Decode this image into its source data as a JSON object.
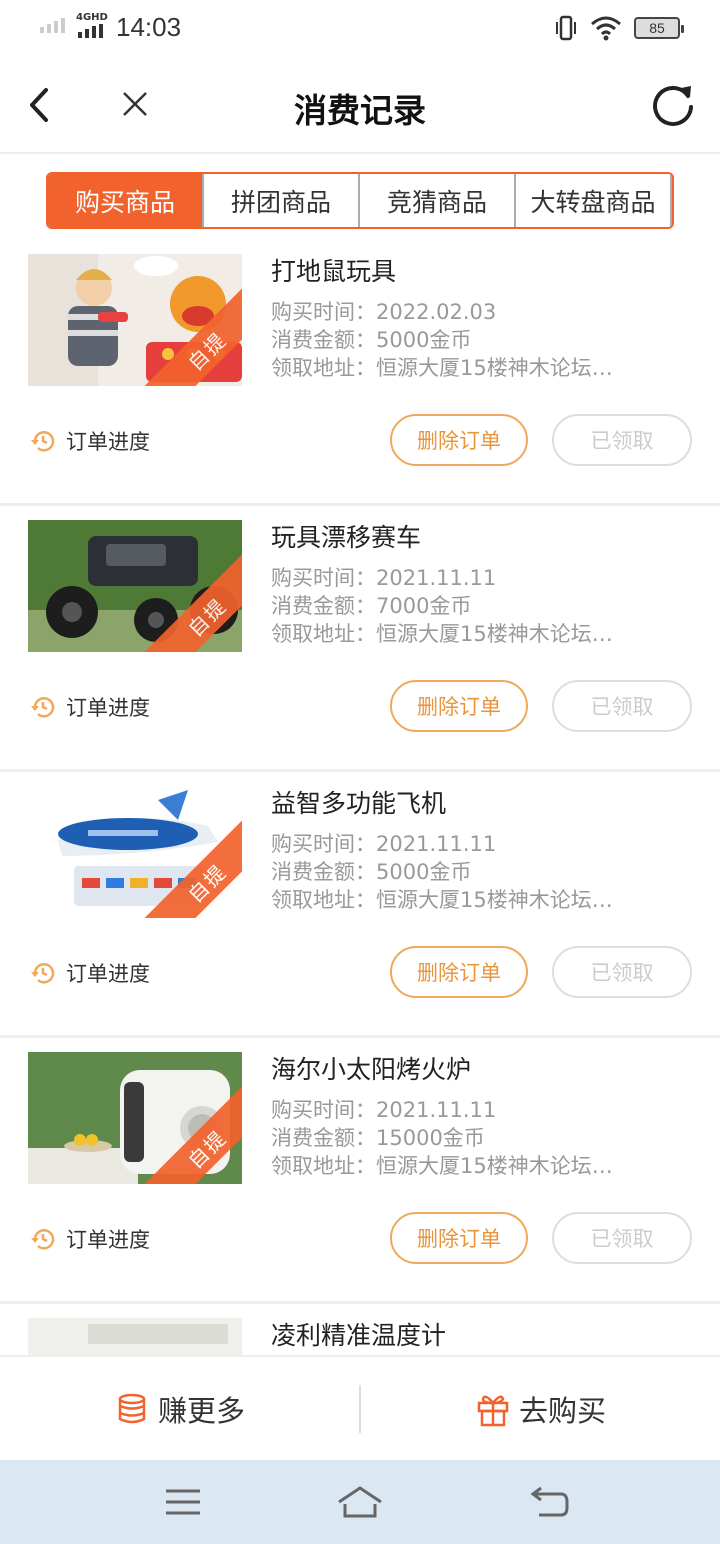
{
  "status_bar": {
    "network": "4GHD",
    "time": "14:03",
    "battery": "85"
  },
  "header": {
    "title": "消费记录"
  },
  "tabs": [
    {
      "label": "购买商品",
      "active": true
    },
    {
      "label": "拼团商品",
      "active": false
    },
    {
      "label": "竞猜商品",
      "active": false
    },
    {
      "label": "大转盘商品",
      "active": false
    }
  ],
  "orders": [
    {
      "name": "打地鼠玩具",
      "purchase_time": "购买时间：2022.02.03",
      "amount": "消费金额：5000金币",
      "address": "领取地址：恒源大厦15楼神木论坛…",
      "ribbon": "自提",
      "progress_label": "订单进度",
      "delete_label": "删除订单",
      "status_label": "已领取"
    },
    {
      "name": "玩具漂移赛车",
      "purchase_time": "购买时间：2021.11.11",
      "amount": "消费金额：7000金币",
      "address": "领取地址：恒源大厦15楼神木论坛…",
      "ribbon": "自提",
      "progress_label": "订单进度",
      "delete_label": "删除订单",
      "status_label": "已领取"
    },
    {
      "name": "益智多功能飞机",
      "purchase_time": "购买时间：2021.11.11",
      "amount": "消费金额：5000金币",
      "address": "领取地址：恒源大厦15楼神木论坛…",
      "ribbon": "自提",
      "progress_label": "订单进度",
      "delete_label": "删除订单",
      "status_label": "已领取"
    },
    {
      "name": "海尔小太阳烤火炉",
      "purchase_time": "购买时间：2021.11.11",
      "amount": "消费金额：15000金币",
      "address": "领取地址：恒源大厦15楼神木论坛…",
      "ribbon": "自提",
      "progress_label": "订单进度",
      "delete_label": "删除订单",
      "status_label": "已领取"
    },
    {
      "name": "凌利精准温度计"
    }
  ],
  "bottom_actions": {
    "earn_more": "赚更多",
    "go_buy": "去购买"
  },
  "colors": {
    "accent": "#f2622d",
    "button_orange": "#e8953c",
    "muted": "#999999"
  }
}
